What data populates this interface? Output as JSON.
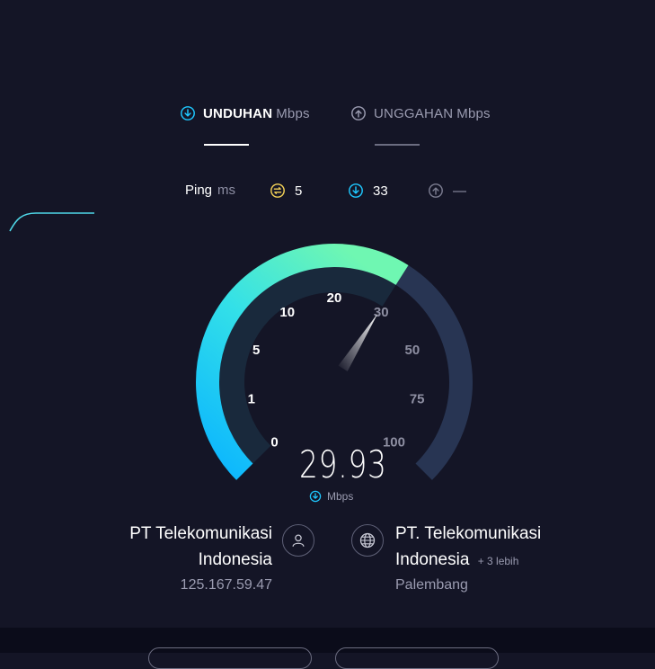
{
  "tabs": {
    "download": {
      "label": "UNDUHAN",
      "unit": "Mbps"
    },
    "upload": {
      "label": "UNGGAHAN",
      "unit": "Mbps"
    }
  },
  "ping": {
    "label": "Ping",
    "unit": "ms",
    "idle": "5",
    "download": "33",
    "upload": "—"
  },
  "gauge": {
    "ticks": [
      "0",
      "1",
      "5",
      "10",
      "20",
      "30",
      "50",
      "75",
      "100"
    ],
    "value": "29.93",
    "unit": "Mbps",
    "fraction": 0.62
  },
  "isp": {
    "name_line1": "PT Telekomunikasi",
    "name_line2": "Indonesia",
    "ip": "125.167.59.47"
  },
  "server": {
    "name_line1": "PT. Telekomunikasi",
    "name_line2": "Indonesia",
    "more": "+ 3 lebih",
    "location": "Palembang"
  },
  "colors": {
    "background": "#141526",
    "accent_cyan": "#1ec8ff",
    "accent_green": "#6ff7b2",
    "track": "#283553",
    "ping_yellow": "#f3d157"
  }
}
